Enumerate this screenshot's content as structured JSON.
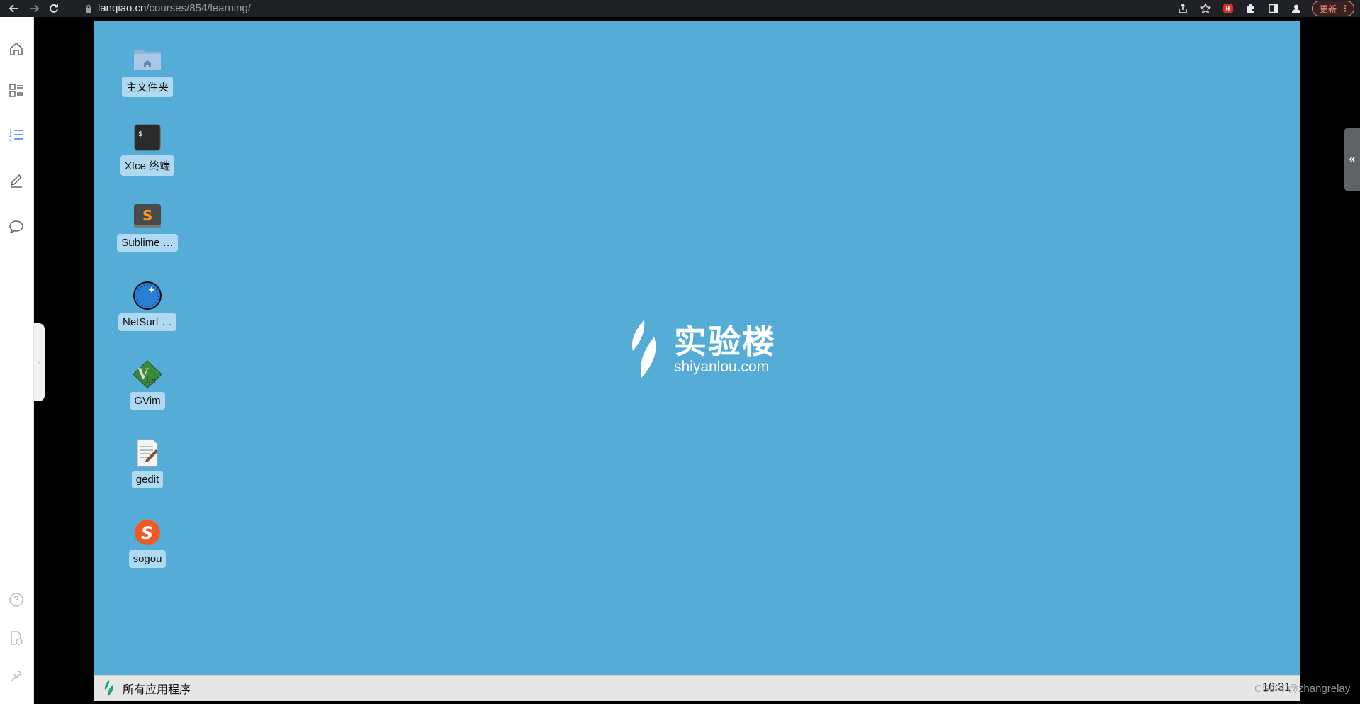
{
  "browser": {
    "url_host": "lanqiao.cn",
    "url_path": "/courses/854/learning/",
    "update_label": "更新"
  },
  "sidebar": {
    "items": [
      {
        "icon": "home-icon"
      },
      {
        "icon": "catalog-icon"
      },
      {
        "icon": "list-icon",
        "active": true
      },
      {
        "icon": "edit-icon"
      },
      {
        "icon": "chat-icon"
      }
    ],
    "bottom_items": [
      {
        "icon": "help-icon"
      },
      {
        "icon": "document-time-icon"
      },
      {
        "icon": "tools-icon"
      }
    ]
  },
  "desktop": {
    "icons": [
      {
        "label": "主文件夹",
        "icon": "home-folder-icon"
      },
      {
        "label": "Xfce 终端",
        "icon": "terminal-icon"
      },
      {
        "label": "Sublime …",
        "icon": "sublime-icon"
      },
      {
        "label": "NetSurf …",
        "icon": "netsurf-icon"
      },
      {
        "label": "GVim",
        "icon": "gvim-icon"
      },
      {
        "label": "gedit",
        "icon": "gedit-icon"
      },
      {
        "label": "sogou",
        "icon": "sogou-icon"
      }
    ],
    "logo": {
      "main": "实验楼",
      "sub": "shiyanlou.com"
    },
    "background_color": "#55acd7"
  },
  "taskbar": {
    "apps_label": "所有应用程序",
    "clock": "16:31"
  },
  "watermark": "CSDN @zhangrelay",
  "right_panel_toggle": "«"
}
